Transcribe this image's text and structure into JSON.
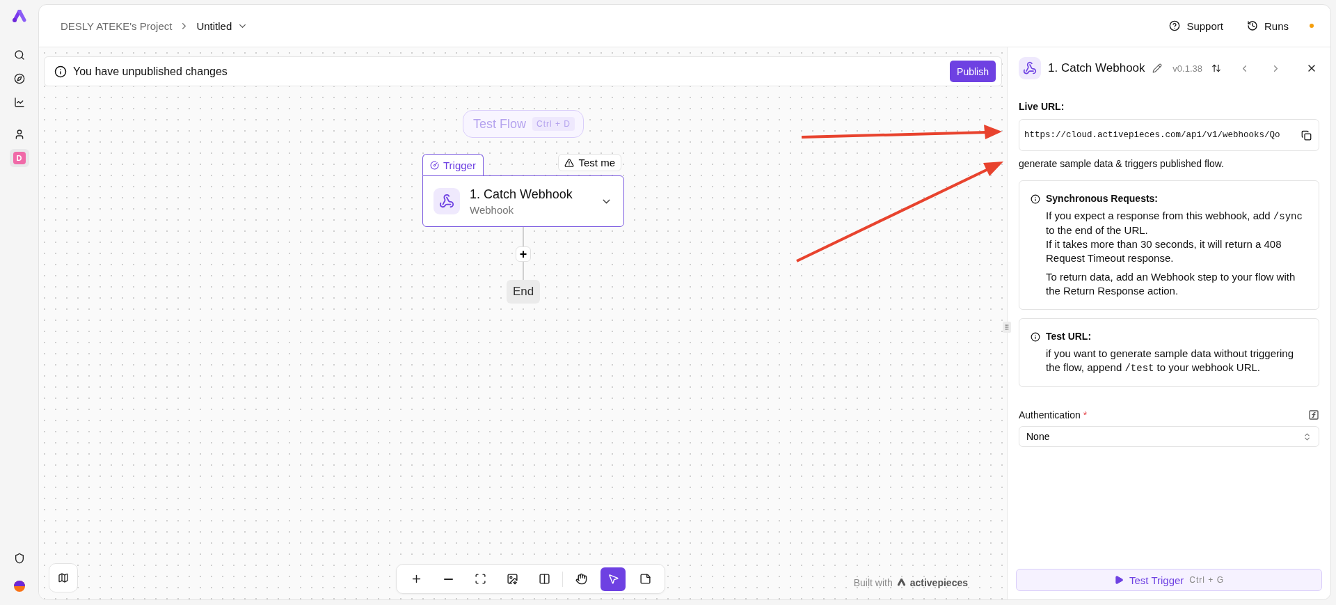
{
  "sidebar": {
    "sections": [
      {
        "items": [
          {
            "kind": "search",
            "selected": false
          },
          {
            "kind": "explore",
            "selected": false
          },
          {
            "kind": "analytics",
            "selected": false
          }
        ]
      },
      {
        "items": [
          {
            "kind": "user",
            "selected": false
          },
          {
            "kind": "project",
            "label": "D",
            "selected": true
          }
        ]
      }
    ],
    "bottom": [
      {
        "kind": "shield",
        "selected": false
      },
      {
        "kind": "avatar",
        "selected": false
      }
    ]
  },
  "header": {
    "project": "DESLY ATEKE's Project",
    "flow": "Untitled",
    "actions": [
      {
        "kind": "support",
        "label": "Support"
      },
      {
        "kind": "runs",
        "label": "Runs"
      }
    ],
    "notification": true
  },
  "banner": {
    "text": "You have unpublished changes",
    "button": "Publish"
  },
  "canvas": {
    "test_flow": {
      "label": "Test Flow",
      "shortcut": "Ctrl + D",
      "disabled": true
    },
    "trigger": {
      "tab": "Trigger",
      "test_badge": "Test me",
      "title": "1. Catch Webhook",
      "subtitle": "Webhook",
      "selected": true
    },
    "add": "+",
    "end": "End",
    "toolbar": {
      "groups": [
        {
          "tools": [
            {
              "kind": "zoom-in",
              "selected": false
            },
            {
              "kind": "zoom-out",
              "selected": false
            },
            {
              "kind": "fit",
              "selected": false
            },
            {
              "kind": "export",
              "selected": false
            },
            {
              "kind": "layout",
              "selected": false
            }
          ]
        },
        {
          "tools": [
            {
              "kind": "pan",
              "selected": false
            },
            {
              "kind": "select",
              "selected": true
            },
            {
              "kind": "note",
              "selected": false
            }
          ]
        }
      ]
    },
    "built_with": {
      "prefix": "Built with",
      "brand": "activepieces"
    }
  },
  "panel": {
    "title": "1. Catch Webhook",
    "version": "v0.1.38",
    "live_url": {
      "label": "Live URL:",
      "value": "https://cloud.activepieces.com/api/v1/webhooks/Qo"
    },
    "description": "generate sample data & triggers published flow.",
    "notes": [
      {
        "title": "Synchronous Requests:",
        "blocks": [
          [
            [
              {
                "kind": "text",
                "text": "If you expect a response from this webhook, add "
              },
              {
                "kind": "code",
                "text": "/sync"
              },
              {
                "kind": "text",
                "text": " to the end of the URL."
              }
            ],
            [
              {
                "kind": "text",
                "text": "If it takes more than 30 seconds, it will return a 408 Request Timeout response."
              }
            ]
          ],
          [
            [
              {
                "kind": "text",
                "text": "To return data, add an Webhook step to your flow with the Return Response action."
              }
            ]
          ]
        ]
      },
      {
        "title": "Test URL:",
        "blocks": [
          [
            [
              {
                "kind": "text",
                "text": "if you want to generate sample data without triggering the flow, append "
              },
              {
                "kind": "code",
                "text": "/test"
              },
              {
                "kind": "text",
                "text": " to your webhook URL."
              }
            ]
          ]
        ]
      }
    ],
    "auth": {
      "label": "Authentication",
      "required_mark": "*",
      "value": "None"
    },
    "test_button": {
      "label": "Test Trigger",
      "shortcut": "Ctrl + G"
    }
  }
}
